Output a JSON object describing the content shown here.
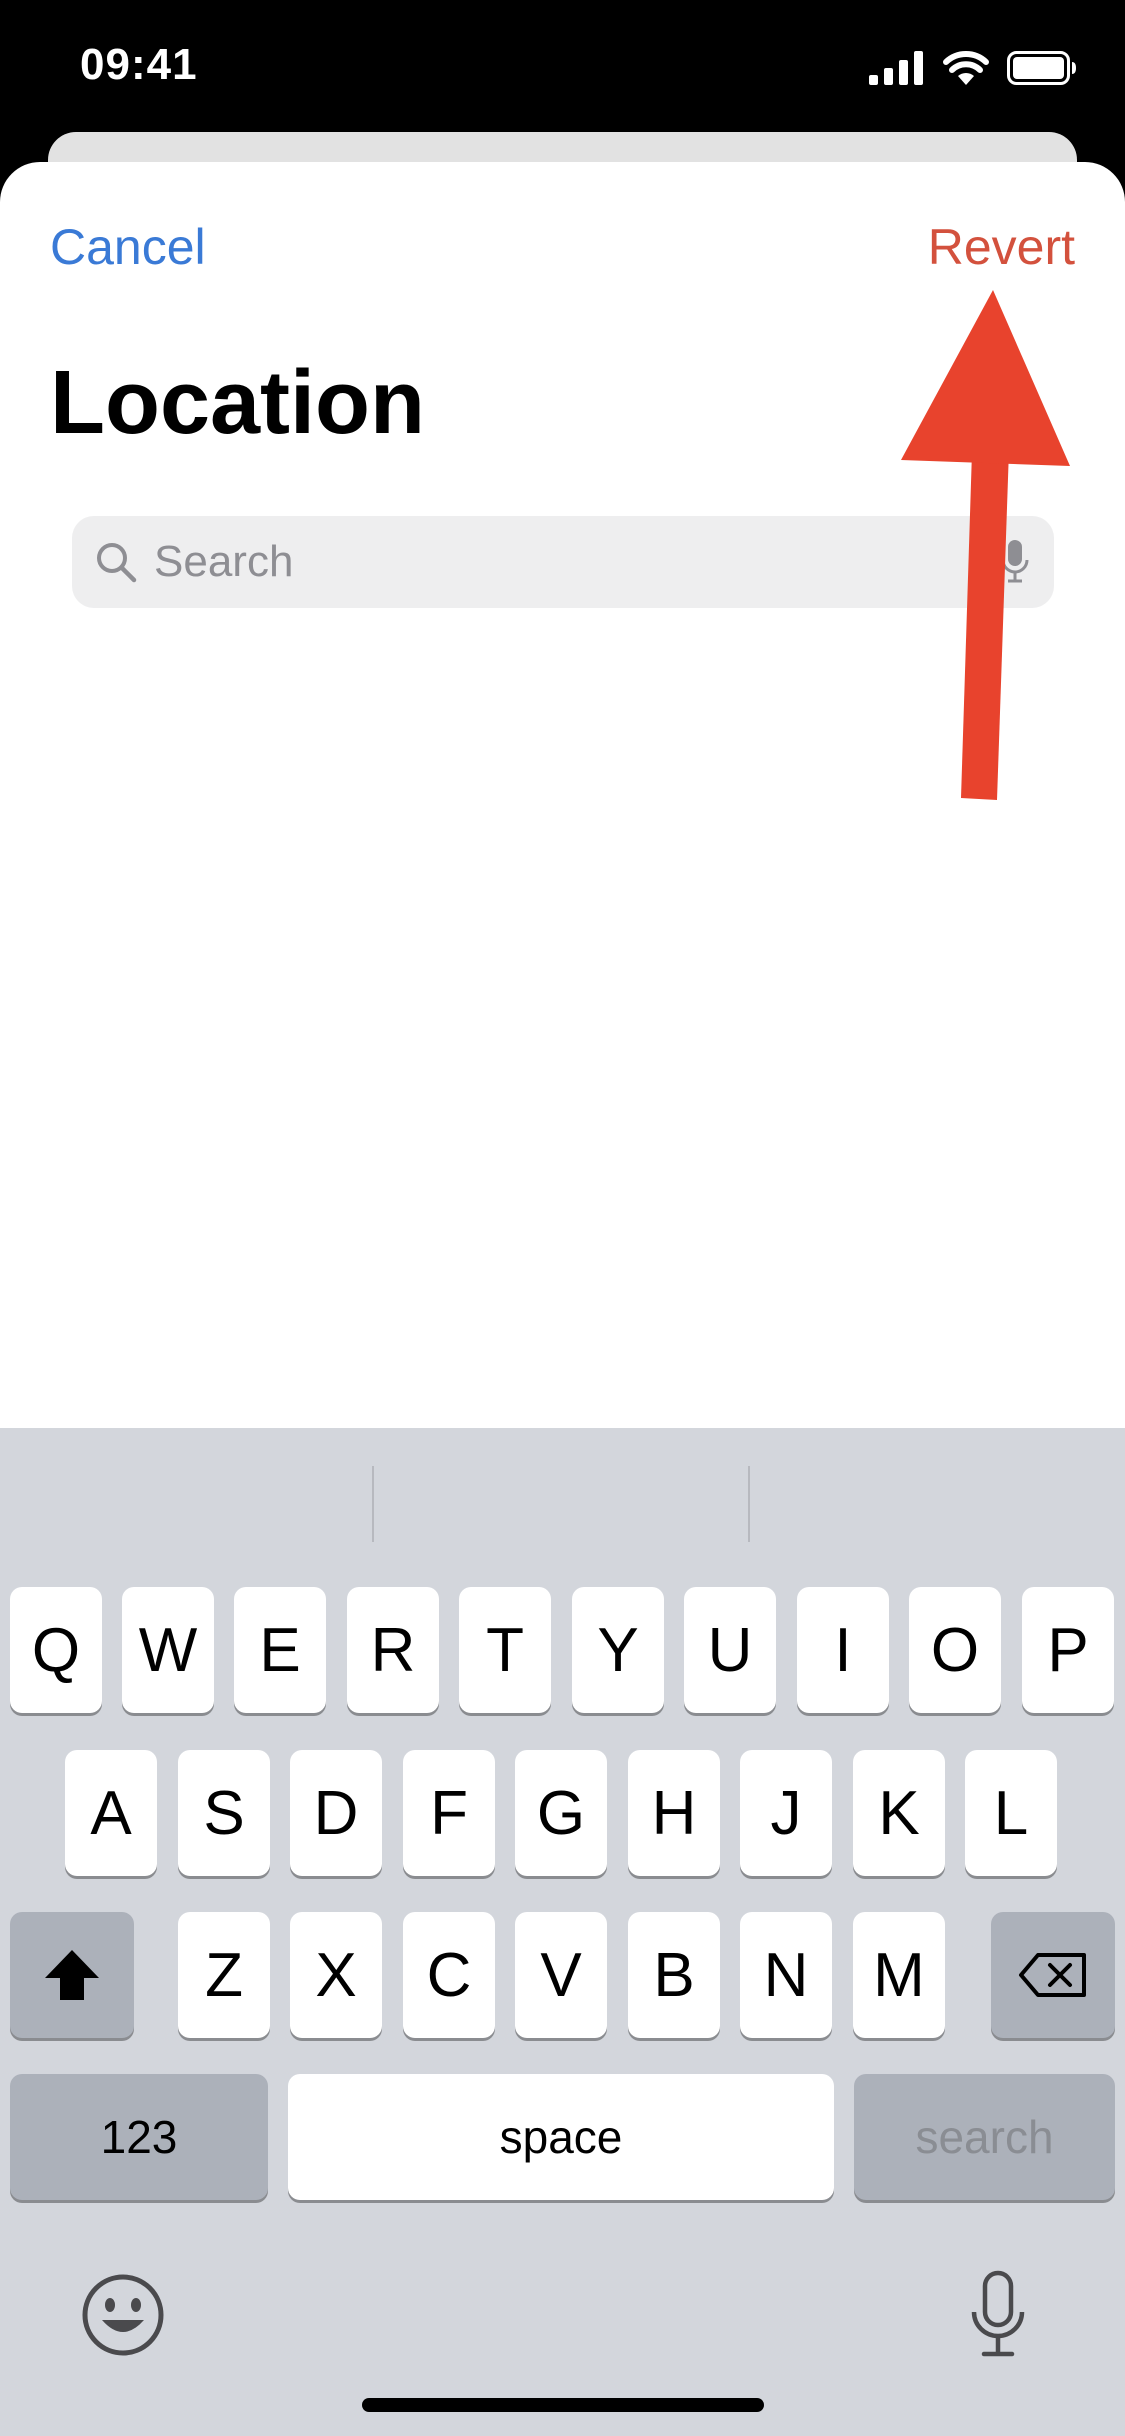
{
  "status_bar": {
    "time": "09:41"
  },
  "nav": {
    "cancel_label": "Cancel",
    "revert_label": "Revert"
  },
  "title": "Location",
  "search": {
    "placeholder": "Search",
    "value": ""
  },
  "keyboard": {
    "row1": [
      "Q",
      "W",
      "E",
      "R",
      "T",
      "Y",
      "U",
      "I",
      "O",
      "P"
    ],
    "row2": [
      "A",
      "S",
      "D",
      "F",
      "G",
      "H",
      "J",
      "K",
      "L"
    ],
    "row3": [
      "Z",
      "X",
      "C",
      "V",
      "B",
      "N",
      "M"
    ],
    "numbers_label": "123",
    "space_label": "space",
    "search_label": "search"
  },
  "colors": {
    "accent": "#3a7ad6",
    "revert": "#d3513d",
    "annotation_arrow": "#e8432d"
  },
  "icons": [
    "signal-icon",
    "wifi-icon",
    "battery-icon",
    "search-icon",
    "microphone-icon",
    "shift-icon",
    "delete-icon",
    "emoji-icon",
    "dictation-icon",
    "arrow-annotation"
  ]
}
